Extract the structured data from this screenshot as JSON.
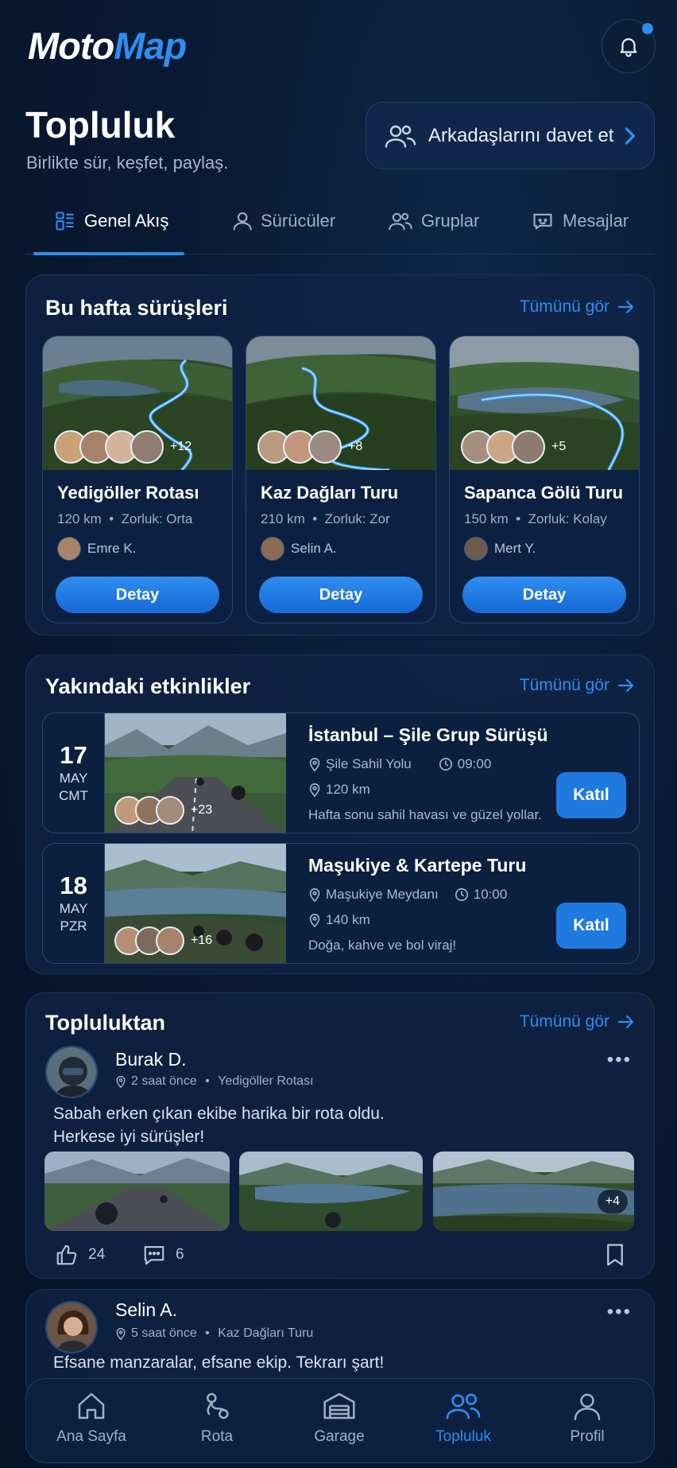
{
  "app": {
    "logo_part1": "Moto",
    "logo_part2": "Map"
  },
  "header": {
    "title": "Topluluk",
    "subtitle": "Birlikte sür, keşfet, paylaş.",
    "invite_label": "Arkadaşlarını davet et"
  },
  "tabs": [
    {
      "label": "Genel Akış",
      "icon": "grid-icon",
      "active": true
    },
    {
      "label": "Sürücüler",
      "icon": "user-icon",
      "active": false
    },
    {
      "label": "Gruplar",
      "icon": "users-icon",
      "active": false
    },
    {
      "label": "Mesajlar",
      "icon": "chat-icon",
      "active": false
    }
  ],
  "weekly": {
    "title": "Bu hafta sürüşleri",
    "see_all": "Tümünü gör",
    "rides": [
      {
        "name": "Yedigöller Rotası",
        "distance": "120 km",
        "difficulty": "Zorluk: Orta",
        "author": "Emre K.",
        "extra": "+12",
        "button": "Detay"
      },
      {
        "name": "Kaz Dağları Turu",
        "distance": "210 km",
        "difficulty": "Zorluk: Zor",
        "author": "Selin A.",
        "extra": "+8",
        "button": "Detay"
      },
      {
        "name": "Sapanca Gölü Turu",
        "distance": "150 km",
        "difficulty": "Zorluk: Kolay",
        "author": "Mert Y.",
        "extra": "+5",
        "button": "Detay"
      }
    ]
  },
  "events": {
    "title": "Yakındaki etkinlikler",
    "see_all": "Tümünü gör",
    "items": [
      {
        "day": "17",
        "month": "MAY",
        "weekday": "CMT",
        "title": "İstanbul – Şile Grup Sürüşü",
        "place": "Şile Sahil Yolu",
        "time": "09:00",
        "distance": "120 km",
        "desc": "Hafta sonu sahil havası ve güzel yollar.",
        "extra": "+23",
        "button": "Katıl"
      },
      {
        "day": "18",
        "month": "MAY",
        "weekday": "PZR",
        "title": "Maşukiye & Kartepe Turu",
        "place": "Maşukiye Meydanı",
        "time": "10:00",
        "distance": "140 km",
        "desc": "Doğa, kahve ve bol viraj!",
        "extra": "+16",
        "button": "Katıl"
      }
    ]
  },
  "community": {
    "title": "Topluluktan",
    "see_all": "Tümünü gör",
    "posts": [
      {
        "name": "Burak D.",
        "time": "2 saat önce",
        "route": "Yedigöller Rotası",
        "text_line1": "Sabah erken çıkan ekibe harika bir rota oldu.",
        "text_line2": "Herkese iyi sürüşler!",
        "more_photos": "+4",
        "likes": "24",
        "comments": "6"
      },
      {
        "name": "Selin A.",
        "time": "5 saat önce",
        "route": "Kaz Dağları Turu",
        "text_line1": "Efsane manzaralar, efsane ekip. Tekrarı şart!"
      }
    ]
  },
  "bottom_nav": [
    {
      "label": "Ana Sayfa",
      "icon": "home-icon",
      "active": false
    },
    {
      "label": "Rota",
      "icon": "route-icon",
      "active": false
    },
    {
      "label": "Garage",
      "icon": "garage-icon",
      "active": false
    },
    {
      "label": "Topluluk",
      "icon": "community-icon",
      "active": true
    },
    {
      "label": "Profil",
      "icon": "profile-icon",
      "active": false
    }
  ],
  "colors": {
    "accent": "#2f8df0",
    "background": "#081a33",
    "panel": "#10244a"
  }
}
